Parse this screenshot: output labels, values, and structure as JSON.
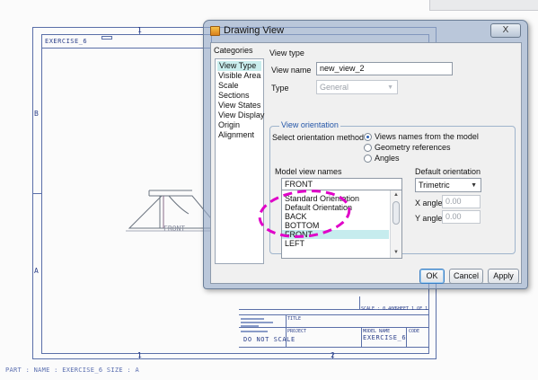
{
  "drawing": {
    "header_text": "EXERCISE_6",
    "zone_letters": [
      "B",
      "A"
    ],
    "zone_numbers": [
      "1",
      "2"
    ],
    "view_note": "FRONT",
    "title_block": {
      "do_not_scale": "DO NOT SCALE",
      "scale_text": "SCALE : 0.400",
      "sheet_text": "SHEET 1 OF 1",
      "title_label": "TITLE",
      "project_label": "PROJECT",
      "model_name_label": "MODEL NAME",
      "model_name": "EXERCISE_6",
      "code_label": "CODE"
    },
    "status_text": "PART : NAME : EXERCISE_6    SIZE : A"
  },
  "dialog": {
    "title": "Drawing View",
    "close_label": "X",
    "categories_label": "Categories",
    "categories": [
      {
        "label": "View Type",
        "selected": true
      },
      {
        "label": "Visible Area",
        "selected": false
      },
      {
        "label": "Scale",
        "selected": false
      },
      {
        "label": "Sections",
        "selected": false
      },
      {
        "label": "View States",
        "selected": false
      },
      {
        "label": "View Display",
        "selected": false
      },
      {
        "label": "Origin",
        "selected": false
      },
      {
        "label": "Alignment",
        "selected": false
      }
    ],
    "view_type_label": "View type",
    "view_name_label": "View name",
    "view_name_value": "new_view_2",
    "type_label": "Type",
    "type_value": "General",
    "orientation_group_title": "View orientation",
    "select_method_label": "Select orientation method",
    "methods": [
      {
        "label": "Views names from the model",
        "checked": true
      },
      {
        "label": "Geometry references",
        "checked": false
      },
      {
        "label": "Angles",
        "checked": false
      }
    ],
    "model_view_names_label": "Model view names",
    "model_view_name_value": "FRONT",
    "model_views": [
      {
        "label": "Standard Orientation",
        "selected": false
      },
      {
        "label": "Default Orientation",
        "selected": false
      },
      {
        "label": "BACK",
        "selected": false
      },
      {
        "label": "BOTTOM",
        "selected": false
      },
      {
        "label": "FRONT",
        "selected": true
      },
      {
        "label": "LEFT",
        "selected": false
      }
    ],
    "default_orientation_label": "Default orientation",
    "default_orientation_value": "Trimetric",
    "x_angle_label": "X angle",
    "x_angle_value": "0.00",
    "y_angle_label": "Y angle",
    "y_angle_value": "0.00",
    "ok_label": "OK",
    "cancel_label": "Cancel",
    "apply_label": "Apply"
  },
  "colors": {
    "sheet_line": "#5a6fa8",
    "annotation": "#e000c8",
    "selection": "#c6ecee",
    "group_title": "#2456a8"
  }
}
